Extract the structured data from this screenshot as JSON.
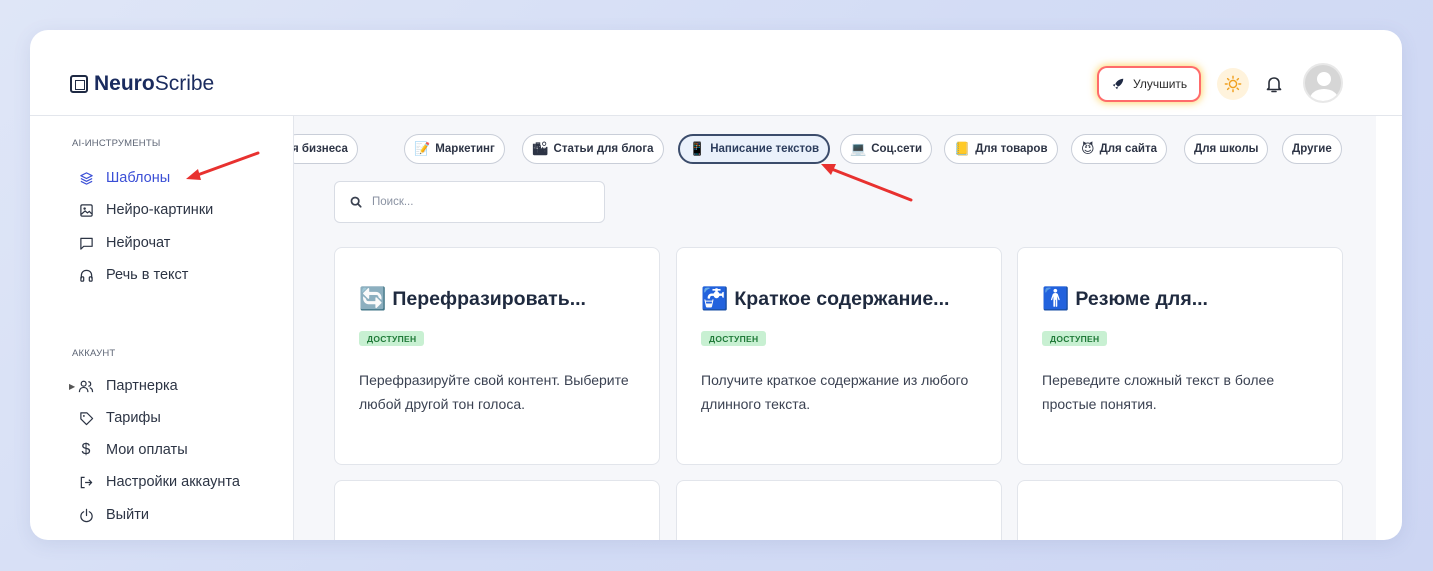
{
  "app": {
    "logo_bold": "Neuro",
    "logo_light": "Scribe"
  },
  "header": {
    "upgrade_label": "Улучшить",
    "theme_icon": "sun-icon",
    "bell_icon": "bell-icon"
  },
  "sidebar": {
    "tools_title": "AI-ИНСТРУМЕНТЫ",
    "tools": [
      {
        "label": "Шаблоны",
        "icon": "layers-icon",
        "active": true
      },
      {
        "label": "Нейро-картинки",
        "icon": "image-icon"
      },
      {
        "label": "Нейрочат",
        "icon": "chat-icon"
      },
      {
        "label": "Речь в текст",
        "icon": "headphones-icon"
      }
    ],
    "account_title": "АККАУНТ",
    "account": [
      {
        "label": "Партнерка",
        "icon": "users-icon"
      },
      {
        "label": "Тарифы",
        "icon": "tag-icon"
      },
      {
        "label": "Мои оплаты",
        "icon": "dollar-icon"
      },
      {
        "label": "Настройки аккаунта",
        "icon": "logout-arrow-icon"
      },
      {
        "label": "Выйти",
        "icon": "power-icon"
      }
    ]
  },
  "categories": [
    {
      "label": "я бизнеса",
      "emoji": ""
    },
    {
      "label": "Маркетинг",
      "emoji": "📝"
    },
    {
      "label": "Статьи для блога",
      "emoji": "🏙"
    },
    {
      "label": "Написание текстов",
      "emoji": "📱",
      "active": true
    },
    {
      "label": "Соц.сети",
      "emoji": "💻"
    },
    {
      "label": "Для товаров",
      "emoji": "📒"
    },
    {
      "label": "Для сайта",
      "emoji": "😈"
    },
    {
      "label": "Для школы",
      "emoji": ""
    },
    {
      "label": "Другие",
      "emoji": ""
    }
  ],
  "search": {
    "placeholder": "Поиск..."
  },
  "cards": [
    {
      "emoji": "🔄",
      "title": "Перефразировать...",
      "badge": "ДОСТУПЕН",
      "desc": "Перефразируйте свой контент. Выберите любой другой тон голоса."
    },
    {
      "emoji": "🚰",
      "title": "Краткое содержание...",
      "badge": "ДОСТУПЕН",
      "desc": "Получите краткое содержание из любого длинного текста."
    },
    {
      "emoji": "🚹",
      "title": "Резюме для...",
      "badge": "ДОСТУПЕН",
      "desc": "Переведите сложный текст в более простые понятия."
    }
  ],
  "colors": {
    "accent": "#3b4fd6",
    "arrow": "#e8312f",
    "badge_bg": "#c8f0d2",
    "badge_text": "#1f7a38"
  }
}
